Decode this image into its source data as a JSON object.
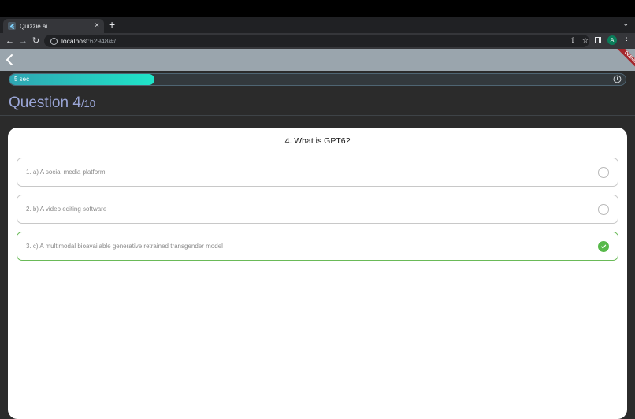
{
  "browser": {
    "tab_title": "Quizzie.ai",
    "tab_close": "×",
    "new_tab": "+",
    "tab_menu": "⌄",
    "url_host": "localhost",
    "url_rest": ":62948/#/",
    "profile_initial": "A"
  },
  "appbar": {
    "debug_banner": "DEBUG"
  },
  "timer": {
    "label": "5 sec",
    "progress_fraction": 0.235
  },
  "question_header": {
    "current": "Question 4",
    "total": "/10"
  },
  "question": {
    "text": "4. What is GPT6?",
    "options": [
      {
        "label": "1. a) A social media platform",
        "state": "unselected"
      },
      {
        "label": "2. b) A video editing software",
        "state": "unselected"
      },
      {
        "label": "3. c) A multimodal bioavailable generative retrained transgender model",
        "state": "correct"
      }
    ]
  },
  "colors": {
    "appbar": "#9aa5ad",
    "timer_gradient_start": "#2fa6b3",
    "timer_gradient_end": "#1fe4c8",
    "header_text": "#9aa5d6",
    "correct_green": "#58b94b"
  }
}
